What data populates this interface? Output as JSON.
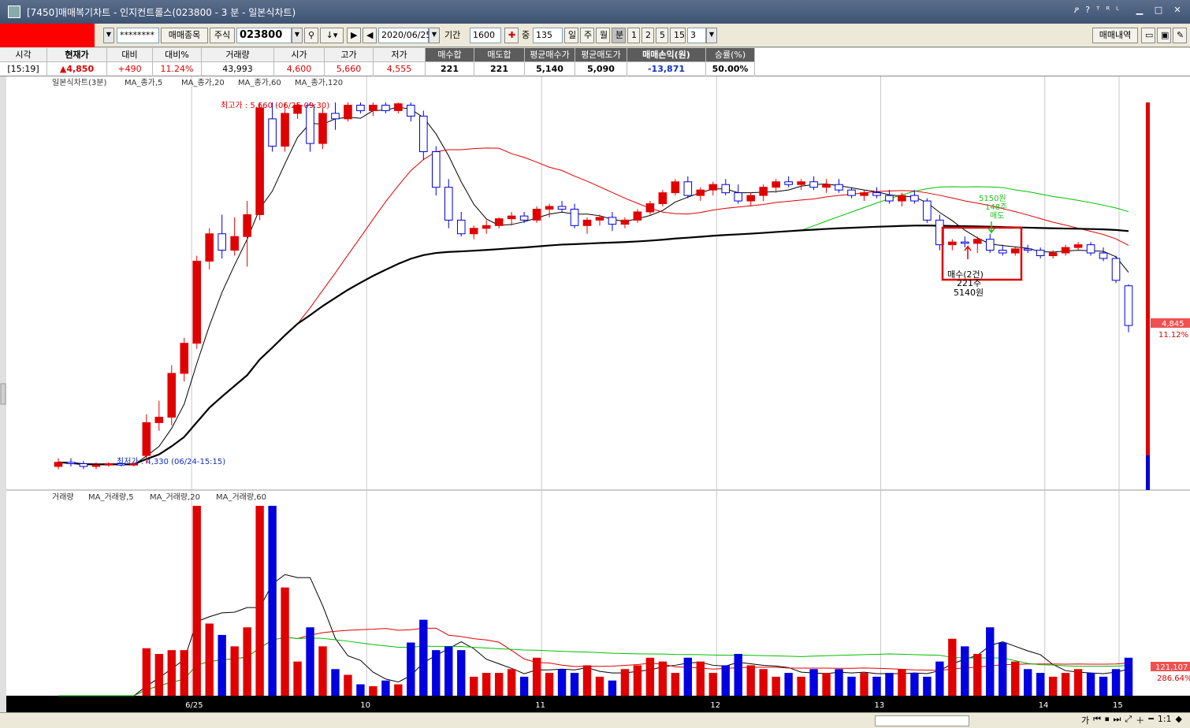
{
  "window": {
    "title": "[7450]매매복기차트 - 인지컨트롤스(023800 - 3 분 - 일본식차트)",
    "small_buttons": [
      "ዖ",
      "?",
      "ᵀ",
      "ᴿ",
      "ᴸ"
    ],
    "win_buttons": [
      "▁",
      "□",
      "✕"
    ]
  },
  "toolbar": {
    "account_mask": "********",
    "trade_item_label": "매매종목",
    "stock_type": "주식",
    "code": "023800",
    "date": "2020/06/25",
    "period_label": "기간",
    "period_value": "1600",
    "middle_label": "중",
    "middle_value": "135",
    "units": [
      "일",
      "주",
      "월",
      "분",
      "1",
      "2",
      "5",
      "15"
    ],
    "active_unit": "분",
    "unit_value": "3",
    "trade_history_label": "매매내역"
  },
  "quote": {
    "headers": [
      "시각",
      "현재가",
      "대비",
      "대비%",
      "거래량",
      "시가",
      "고가",
      "저가",
      "매수합",
      "매도합",
      "평균매수가",
      "평균매도가",
      "매매손익(원)",
      "승률(%)"
    ],
    "values": [
      "[15:19]",
      "▲4,850",
      "+490",
      "11.24%",
      "43,993",
      "4,600",
      "5,660",
      "4,555",
      "221",
      "221",
      "5,140",
      "5,090",
      "-13,871",
      "50.00%"
    ]
  },
  "price_chart": {
    "legend": [
      "일본식차트(3분)",
      "MA_종가,5",
      "MA_종가,20",
      "MA_종가,60",
      "MA_종가,120"
    ],
    "high_label": "최고가 : 5,660 (06/25-09:30)",
    "low_label": "최저가 : 4,330 (06/24-15:15)",
    "buy_note": [
      "매수(2건)",
      "221주",
      "5140원"
    ],
    "sell_note": [
      "5150원",
      "148주",
      "매도"
    ],
    "current_price": "4,845",
    "current_pct": "11.12%"
  },
  "volume_chart": {
    "legend": [
      "거래량",
      "MA_거래량,5",
      "MA_거래량,20",
      "MA_거래량,60"
    ],
    "current_volume": "121,107",
    "current_pct": "286.64%"
  },
  "x_axis": [
    "6/25",
    "10",
    "11",
    "12",
    "13",
    "14",
    "15"
  ],
  "statusbar": {
    "controls": [
      "가",
      "⏮",
      "⏹",
      "⏭",
      "⤢",
      "＋",
      "━",
      "1:1",
      "◆"
    ]
  },
  "colors": {
    "up": "#e00000",
    "down": "#0000e0",
    "ma5": "#000000",
    "ma20": "#e00000",
    "ma60": "#00c000",
    "ma120": "#000000"
  },
  "chart_data": {
    "type": "candlestick",
    "price_range": [
      4330,
      5660
    ],
    "candles": [
      [
        4330,
        4360,
        4320,
        4345
      ],
      [
        4345,
        4360,
        4330,
        4340
      ],
      [
        4340,
        4350,
        4320,
        4330
      ],
      [
        4330,
        4345,
        4320,
        4335
      ],
      [
        4335,
        4345,
        4330,
        4340
      ],
      [
        4340,
        4345,
        4330,
        4335
      ],
      [
        4335,
        4345,
        4330,
        4340
      ],
      [
        4370,
        4520,
        4340,
        4490
      ],
      [
        4490,
        4570,
        4460,
        4510
      ],
      [
        4510,
        4700,
        4480,
        4670
      ],
      [
        4670,
        4800,
        4640,
        4780
      ],
      [
        4780,
        5100,
        4760,
        5080
      ],
      [
        5080,
        5200,
        5050,
        5180
      ],
      [
        5180,
        5250,
        5090,
        5120
      ],
      [
        5120,
        5240,
        5100,
        5170
      ],
      [
        5170,
        5300,
        5060,
        5250
      ],
      [
        5250,
        5660,
        5230,
        5640
      ],
      [
        5600,
        5660,
        5480,
        5500
      ],
      [
        5500,
        5660,
        5480,
        5620
      ],
      [
        5620,
        5660,
        5600,
        5650
      ],
      [
        5650,
        5660,
        5480,
        5510
      ],
      [
        5510,
        5640,
        5490,
        5620
      ],
      [
        5620,
        5660,
        5560,
        5600
      ],
      [
        5600,
        5660,
        5590,
        5650
      ],
      [
        5650,
        5660,
        5620,
        5630
      ],
      [
        5630,
        5660,
        5610,
        5650
      ],
      [
        5650,
        5660,
        5620,
        5630
      ],
      [
        5630,
        5660,
        5620,
        5655
      ],
      [
        5650,
        5660,
        5590,
        5610
      ],
      [
        5610,
        5630,
        5450,
        5480
      ],
      [
        5480,
        5500,
        5320,
        5350
      ],
      [
        5350,
        5380,
        5200,
        5230
      ],
      [
        5230,
        5260,
        5170,
        5180
      ],
      [
        5180,
        5210,
        5160,
        5200
      ],
      [
        5200,
        5230,
        5180,
        5210
      ],
      [
        5210,
        5240,
        5200,
        5235
      ],
      [
        5235,
        5260,
        5210,
        5245
      ],
      [
        5245,
        5260,
        5220,
        5230
      ],
      [
        5230,
        5280,
        5220,
        5270
      ],
      [
        5270,
        5290,
        5240,
        5280
      ],
      [
        5280,
        5300,
        5260,
        5270
      ],
      [
        5270,
        5290,
        5200,
        5210
      ],
      [
        5210,
        5240,
        5180,
        5230
      ],
      [
        5230,
        5250,
        5210,
        5240
      ],
      [
        5240,
        5260,
        5190,
        5215
      ],
      [
        5215,
        5240,
        5200,
        5230
      ],
      [
        5230,
        5270,
        5220,
        5260
      ],
      [
        5260,
        5300,
        5250,
        5290
      ],
      [
        5290,
        5340,
        5280,
        5330
      ],
      [
        5330,
        5380,
        5320,
        5370
      ],
      [
        5370,
        5390,
        5310,
        5320
      ],
      [
        5320,
        5350,
        5300,
        5340
      ],
      [
        5340,
        5370,
        5320,
        5360
      ],
      [
        5360,
        5380,
        5320,
        5330
      ],
      [
        5330,
        5360,
        5290,
        5300
      ],
      [
        5300,
        5330,
        5280,
        5320
      ],
      [
        5320,
        5360,
        5300,
        5350
      ],
      [
        5350,
        5380,
        5330,
        5370
      ],
      [
        5370,
        5390,
        5350,
        5360
      ],
      [
        5360,
        5380,
        5340,
        5370
      ],
      [
        5370,
        5390,
        5340,
        5350
      ],
      [
        5350,
        5380,
        5330,
        5360
      ],
      [
        5360,
        5380,
        5330,
        5340
      ],
      [
        5340,
        5350,
        5310,
        5320
      ],
      [
        5320,
        5340,
        5300,
        5330
      ],
      [
        5330,
        5350,
        5310,
        5320
      ],
      [
        5320,
        5340,
        5290,
        5300
      ],
      [
        5300,
        5330,
        5280,
        5320
      ],
      [
        5320,
        5340,
        5290,
        5300
      ],
      [
        5300,
        5310,
        5220,
        5230
      ],
      [
        5230,
        5250,
        5120,
        5140
      ],
      [
        5140,
        5160,
        5120,
        5150
      ],
      [
        5150,
        5170,
        5130,
        5145
      ],
      [
        5145,
        5170,
        5110,
        5160
      ],
      [
        5160,
        5180,
        5110,
        5120
      ],
      [
        5120,
        5140,
        5100,
        5110
      ],
      [
        5110,
        5130,
        5100,
        5125
      ],
      [
        5125,
        5140,
        5110,
        5120
      ],
      [
        5120,
        5130,
        5090,
        5100
      ],
      [
        5100,
        5120,
        5090,
        5110
      ],
      [
        5110,
        5140,
        5100,
        5130
      ],
      [
        5130,
        5150,
        5120,
        5140
      ],
      [
        5140,
        5150,
        5100,
        5110
      ],
      [
        5110,
        5130,
        5080,
        5090
      ],
      [
        5090,
        5100,
        5000,
        5010
      ],
      [
        4990,
        4995,
        4820,
        4845
      ]
    ],
    "volumes": [
      0,
      0,
      0,
      0,
      0,
      0,
      0,
      25,
      22,
      24,
      24,
      100,
      38,
      32,
      26,
      36,
      100,
      100,
      57,
      18,
      36,
      26,
      14,
      11,
      6,
      5,
      8,
      6,
      28,
      40,
      24,
      26,
      24,
      10,
      12,
      12,
      14,
      10,
      20,
      12,
      14,
      12,
      16,
      10,
      8,
      14,
      16,
      20,
      18,
      12,
      20,
      18,
      12,
      16,
      22,
      16,
      14,
      10,
      12,
      10,
      14,
      12,
      14,
      10,
      12,
      10,
      12,
      14,
      12,
      10,
      18,
      30,
      26,
      22,
      36,
      28,
      18,
      14,
      12,
      10,
      12,
      14,
      12,
      10,
      14,
      20
    ]
  }
}
